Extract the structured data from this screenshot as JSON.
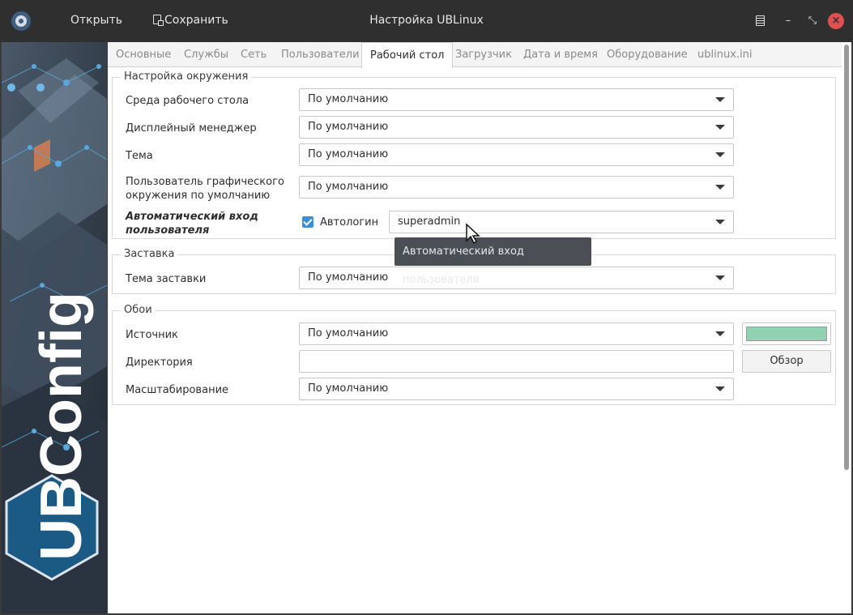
{
  "window": {
    "title": "Настройка UBLinux",
    "open_label": "Открыть",
    "save_label": "Сохранить"
  },
  "banner": {
    "logo_text": "UBConfig"
  },
  "tabs": [
    {
      "label": "Основные"
    },
    {
      "label": "Службы"
    },
    {
      "label": "Сеть"
    },
    {
      "label": "Пользователи"
    },
    {
      "label": "Рабочий стол",
      "active": true
    },
    {
      "label": "Загрузчик"
    },
    {
      "label": "Дата и время"
    },
    {
      "label": "Оборудование"
    },
    {
      "label": "ublinux.ini"
    }
  ],
  "environment": {
    "title": "Настройка окружения",
    "desktop_env": {
      "label": "Среда рабочего стола",
      "value": "По умолчанию"
    },
    "display_manager": {
      "label": "Дисплейный менеджер",
      "value": "По умолчанию"
    },
    "theme": {
      "label": "Тема",
      "value": "По умолчанию"
    },
    "default_user": {
      "label_line1": "Пользователь графического",
      "label_line2": "окружения по умолчанию",
      "value": "По умолчанию"
    },
    "autologin": {
      "label_line1": "Автоматический вход",
      "label_line2": "пользователя",
      "checkbox_label": "Автологин",
      "checked": true,
      "user_value": "superadmin"
    }
  },
  "screensaver": {
    "title": "Заставка",
    "theme": {
      "label": "Тема заставки",
      "value": "По умолчанию"
    }
  },
  "wallpaper": {
    "title": "Обои",
    "source": {
      "label": "Источник",
      "value": "По умолчанию",
      "color": "#8fd1b0"
    },
    "directory": {
      "label": "Директория",
      "value": "",
      "browse_label": "Обзор"
    },
    "scaling": {
      "label": "Масштабирование",
      "value": "По умолчанию"
    }
  },
  "tooltip": {
    "text": "Автоматический вход пользователя"
  },
  "colors": {
    "titlebar": "#2f2f2f",
    "accent": "#3c8fd6",
    "close": "#e05050"
  }
}
